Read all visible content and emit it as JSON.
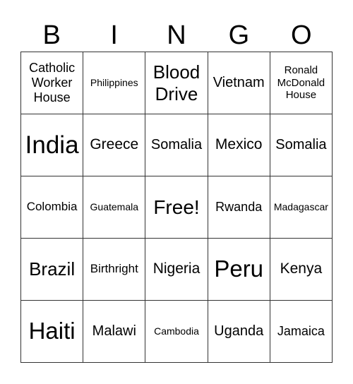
{
  "header": [
    "B",
    "I",
    "N",
    "G",
    "O"
  ],
  "cells": [
    [
      {
        "text": "Catholic Worker House",
        "size": "s18"
      },
      {
        "text": "Philippines",
        "size": "s14"
      },
      {
        "text": "Blood Drive",
        "size": "s26"
      },
      {
        "text": "Vietnam",
        "size": "s20"
      },
      {
        "text": "Ronald McDonald House",
        "size": "s15"
      }
    ],
    [
      {
        "text": "India",
        "size": "s35"
      },
      {
        "text": "Greece",
        "size": "s21"
      },
      {
        "text": "Somalia",
        "size": "s20"
      },
      {
        "text": "Mexico",
        "size": "s21"
      },
      {
        "text": "Somalia",
        "size": "s20"
      }
    ],
    [
      {
        "text": "Colombia",
        "size": "s17"
      },
      {
        "text": "Guatemala",
        "size": "s14"
      },
      {
        "text": "Free!",
        "size": "s28"
      },
      {
        "text": "Rwanda",
        "size": "s18"
      },
      {
        "text": "Madagascar",
        "size": "s14"
      }
    ],
    [
      {
        "text": "Brazil",
        "size": "s26"
      },
      {
        "text": "Birthright",
        "size": "s17"
      },
      {
        "text": "Nigeria",
        "size": "s21"
      },
      {
        "text": "Peru",
        "size": "s32"
      },
      {
        "text": "Kenya",
        "size": "s21"
      }
    ],
    [
      {
        "text": "Haiti",
        "size": "s32"
      },
      {
        "text": "Malawi",
        "size": "s20"
      },
      {
        "text": "Cambodia",
        "size": "s14"
      },
      {
        "text": "Uganda",
        "size": "s20"
      },
      {
        "text": "Jamaica",
        "size": "s18"
      }
    ]
  ]
}
